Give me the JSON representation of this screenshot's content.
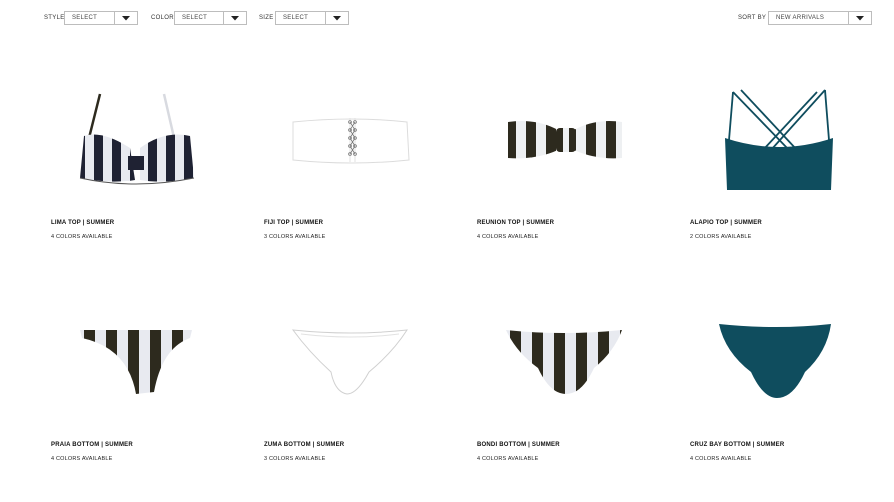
{
  "filters": {
    "style": {
      "label": "STYLE",
      "value": "SELECT",
      "icon": "chevron-down-icon"
    },
    "color": {
      "label": "COLOR",
      "value": "SELECT",
      "icon": "chevron-down-icon"
    },
    "size": {
      "label": "SIZE",
      "value": "SELECT",
      "icon": "chevron-down-icon"
    },
    "sort": {
      "label": "SORT BY",
      "value": "NEW ARRIVALS",
      "icon": "chevron-down-icon"
    }
  },
  "colors": {
    "teal": "#0f4d5e",
    "olive": "#2d2a1e",
    "navy": "#1f2233",
    "stripe_white": "#e8eaf0",
    "white": "#ffffff"
  },
  "products": [
    {
      "name": "LIMA TOP | SUMMER",
      "colors": "4 COLORS AVAILABLE",
      "image": "striped-underwire-bikini-top"
    },
    {
      "name": "FIJI TOP | SUMMER",
      "colors": "3 COLORS AVAILABLE",
      "image": "white-lace-up-bandeau-top"
    },
    {
      "name": "REUNION TOP | SUMMER",
      "colors": "4 COLORS AVAILABLE",
      "image": "striped-twist-bandeau-top"
    },
    {
      "name": "ALAPIO TOP | SUMMER",
      "colors": "2 COLORS AVAILABLE",
      "image": "teal-strappy-bralette-top"
    },
    {
      "name": "PRAIA BOTTOM | SUMMER",
      "colors": "4 COLORS AVAILABLE",
      "image": "striped-cheeky-bikini-bottom"
    },
    {
      "name": "ZUMA BOTTOM | SUMMER",
      "colors": "3 COLORS AVAILABLE",
      "image": "white-bikini-bottom"
    },
    {
      "name": "BONDI BOTTOM | SUMMER",
      "colors": "4 COLORS AVAILABLE",
      "image": "striped-hipster-bikini-bottom"
    },
    {
      "name": "CRUZ BAY BOTTOM | SUMMER",
      "colors": "4 COLORS AVAILABLE",
      "image": "teal-bikini-bottom"
    }
  ]
}
